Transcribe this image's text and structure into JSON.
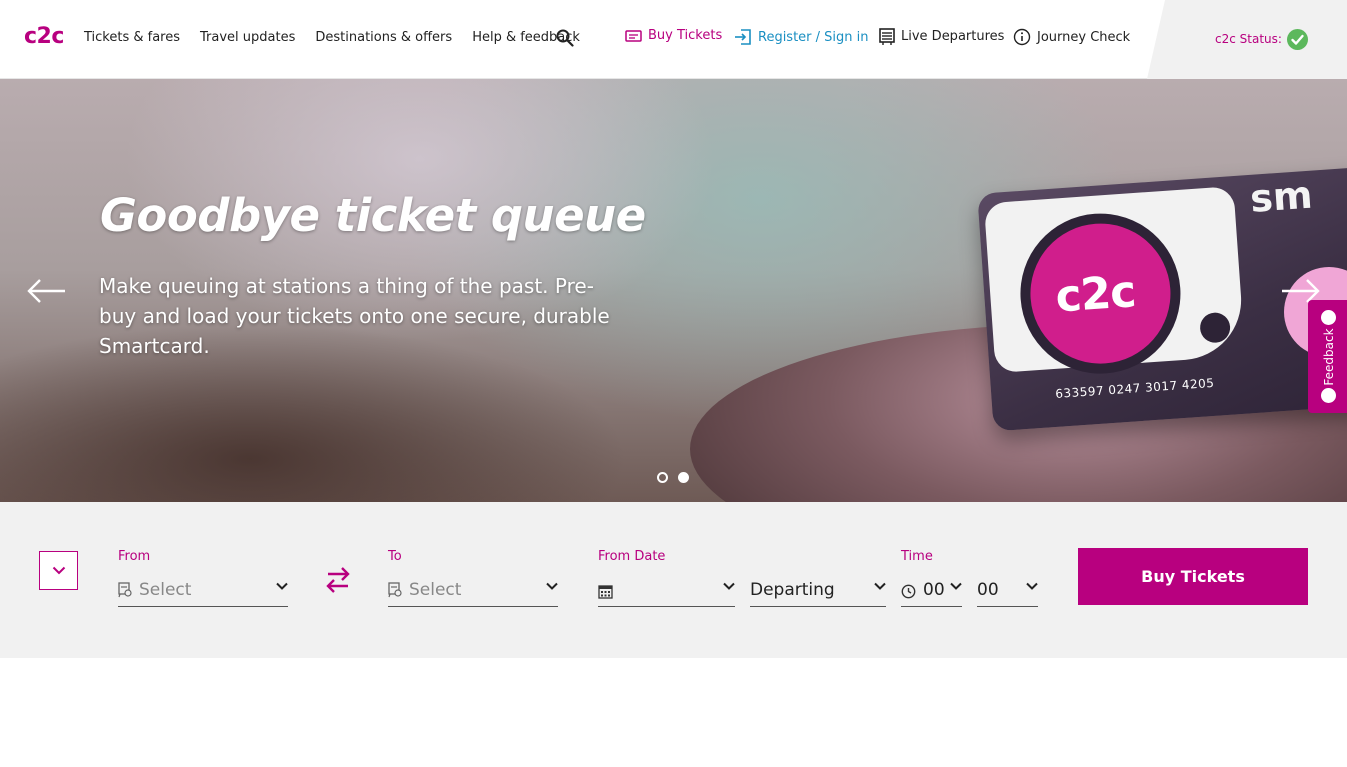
{
  "header": {
    "logo": "c2c",
    "nav": [
      "Tickets & fares",
      "Travel updates",
      "Destinations & offers",
      "Help & feedback"
    ],
    "utility": {
      "buy_tickets": "Buy Tickets",
      "register": "Register / Sign in",
      "live_departures": "Live Departures",
      "journey_check": "Journey Check"
    },
    "status_label": "c2c Status:"
  },
  "hero": {
    "title": "Goodbye ticket queue",
    "text": "Make queuing at stations a thing of the past. Pre-buy and load your tickets onto one secure, durable Smartcard.",
    "card_logo": "c2c",
    "card_number": "633597 0247 3017 4205",
    "card_brand_partial": "sm",
    "active_slide": 2,
    "slide_count": 2
  },
  "feedback_tab": {
    "label": "Feedback"
  },
  "search": {
    "from": {
      "label": "From",
      "placeholder": "Select"
    },
    "to": {
      "label": "To",
      "placeholder": "Select"
    },
    "date": {
      "label": "From Date",
      "value": ""
    },
    "mode": {
      "value": "Departing"
    },
    "time": {
      "label": "Time",
      "hour": "00",
      "minute": "00"
    },
    "submit": "Buy Tickets"
  },
  "colors": {
    "brand": "#b8007f",
    "link_blue": "#1a8fc2",
    "status_ok": "#5cb85c",
    "search_bg": "#f1f1f1"
  }
}
